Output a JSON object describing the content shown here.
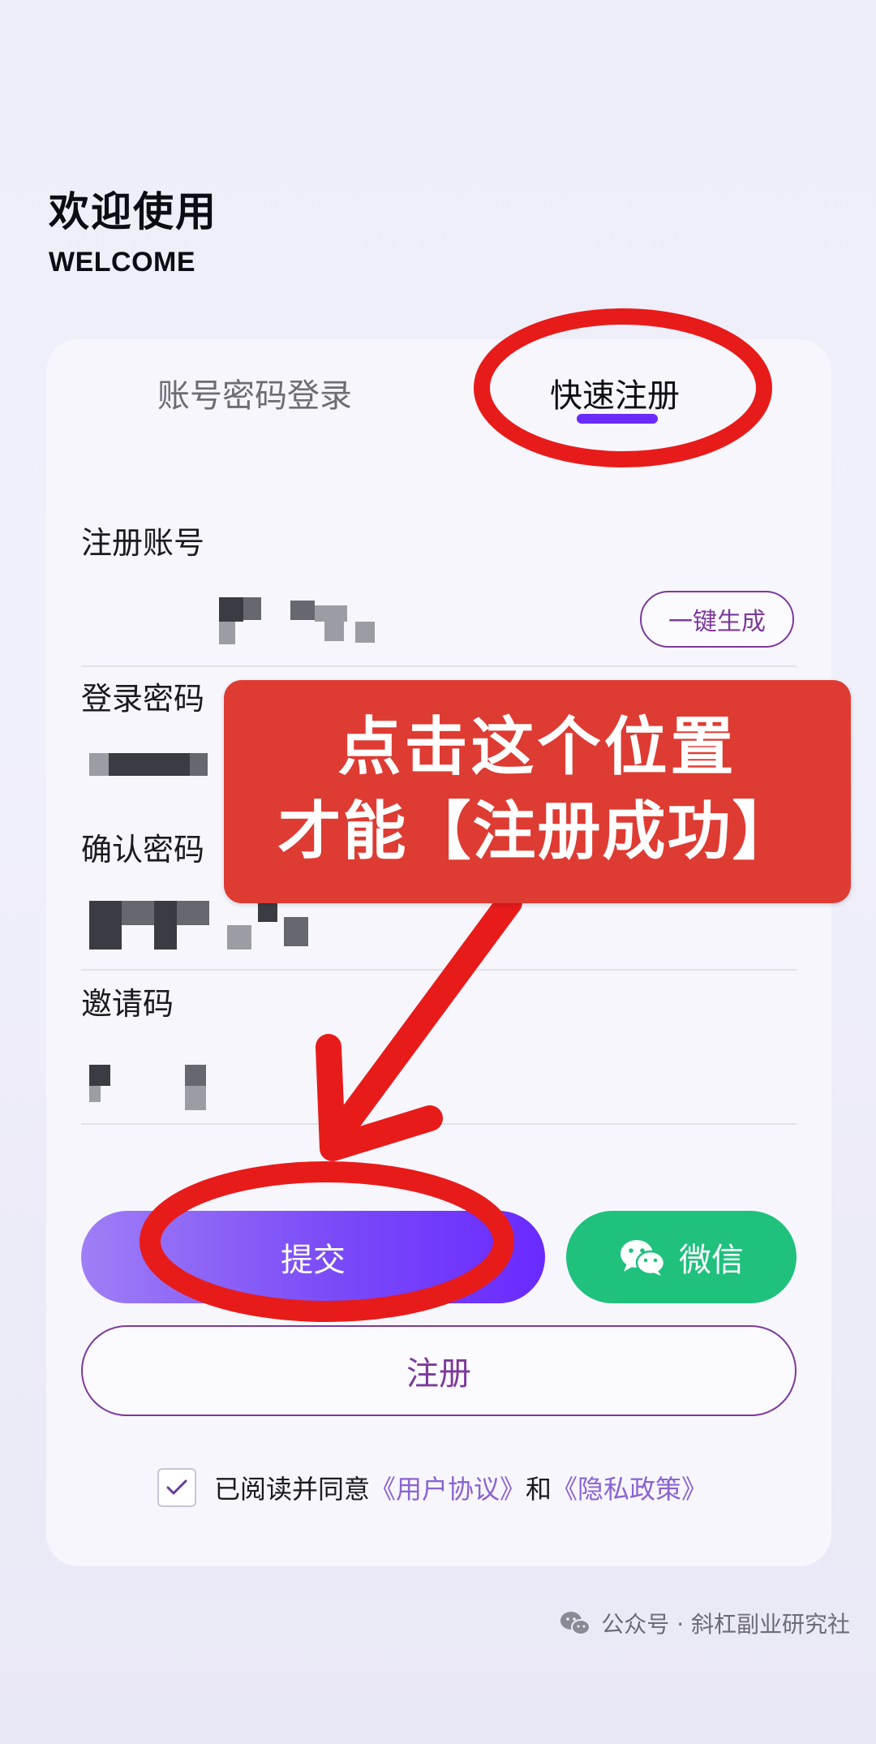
{
  "header": {
    "title": "欢迎使用",
    "subtitle": "WELCOME"
  },
  "tabs": [
    {
      "label": "账号密码登录",
      "active": false
    },
    {
      "label": "快速注册",
      "active": true
    }
  ],
  "form": {
    "account_label": "注册账号",
    "generate_label": "一键生成",
    "password_label": "登录密码",
    "confirm_label": "确认密码",
    "invite_label": "邀请码"
  },
  "buttons": {
    "submit_label": "提交",
    "wechat_label": "微信",
    "register_label": "注册"
  },
  "agreement": {
    "prefix": "已阅读并同意",
    "user_agreement": "《用户协议》",
    "conjunction": "和",
    "privacy_policy": "《隐私政策》",
    "checked": true
  },
  "annotation": {
    "line1": "点击这个位置",
    "line2": "才能【注册成功】"
  },
  "footer": {
    "source": "公众号 · 斜杠副业研究社"
  },
  "colors": {
    "accent": "#6a2bff",
    "outline": "#7c3a9a",
    "wechat": "#1fc17d",
    "annotation_red": "#de3b33"
  }
}
